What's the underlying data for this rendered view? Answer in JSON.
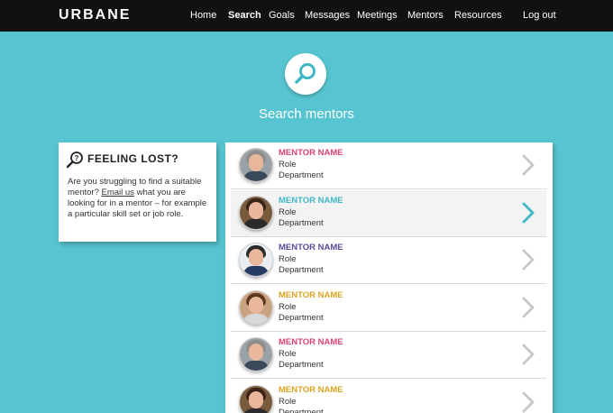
{
  "brand": {
    "logo_text": "URBANE"
  },
  "nav": {
    "items": [
      {
        "label": "Home",
        "active": false
      },
      {
        "label": "Search",
        "active": true
      },
      {
        "label": "Goals",
        "active": false
      },
      {
        "label": "Messages",
        "active": false
      },
      {
        "label": "Meetings",
        "active": false
      },
      {
        "label": "Mentors",
        "active": false
      },
      {
        "label": "Resources",
        "active": false
      }
    ],
    "logout_label": "Log out"
  },
  "hero": {
    "icon": "search-icon",
    "title": "Search mentors"
  },
  "feeling_lost": {
    "icon": "question-magnifier-icon",
    "title": "FEELING LOST?",
    "text_before": "Are you struggling to find a suitable mentor? ",
    "link_text": "Email us",
    "text_after": " what you are looking for in a mentor – for example a particular skill set or job role."
  },
  "mentors": [
    {
      "name": "MENTOR NAME",
      "role": "Role",
      "department": "Department",
      "name_color": "#d9427a",
      "chevron_color": "#c7c7c7",
      "highlighted": false,
      "avatar": "man-grey-hair"
    },
    {
      "name": "MENTOR NAME",
      "role": "Role",
      "department": "Department",
      "name_color": "#3fb8c6",
      "chevron_color": "#3fb8c6",
      "highlighted": true,
      "avatar": "woman-dark-hair"
    },
    {
      "name": "MENTOR NAME",
      "role": "Role",
      "department": "Department",
      "name_color": "#5b4a9a",
      "chevron_color": "#c7c7c7",
      "highlighted": false,
      "avatar": "man-suit"
    },
    {
      "name": "MENTOR NAME",
      "role": "Role",
      "department": "Department",
      "name_color": "#d9a520",
      "chevron_color": "#c7c7c7",
      "highlighted": false,
      "avatar": "woman-smiling"
    },
    {
      "name": "MENTOR NAME",
      "role": "Role",
      "department": "Department",
      "name_color": "#d9427a",
      "chevron_color": "#c7c7c7",
      "highlighted": false,
      "avatar": "man-grey-hair"
    },
    {
      "name": "MENTOR NAME",
      "role": "Role",
      "department": "Department",
      "name_color": "#d9a520",
      "chevron_color": "#c7c7c7",
      "highlighted": false,
      "avatar": "woman-dark-hair"
    }
  ],
  "colors": {
    "background": "#57c5d1",
    "topbar": "#111111",
    "accent": "#3fb8c6"
  }
}
